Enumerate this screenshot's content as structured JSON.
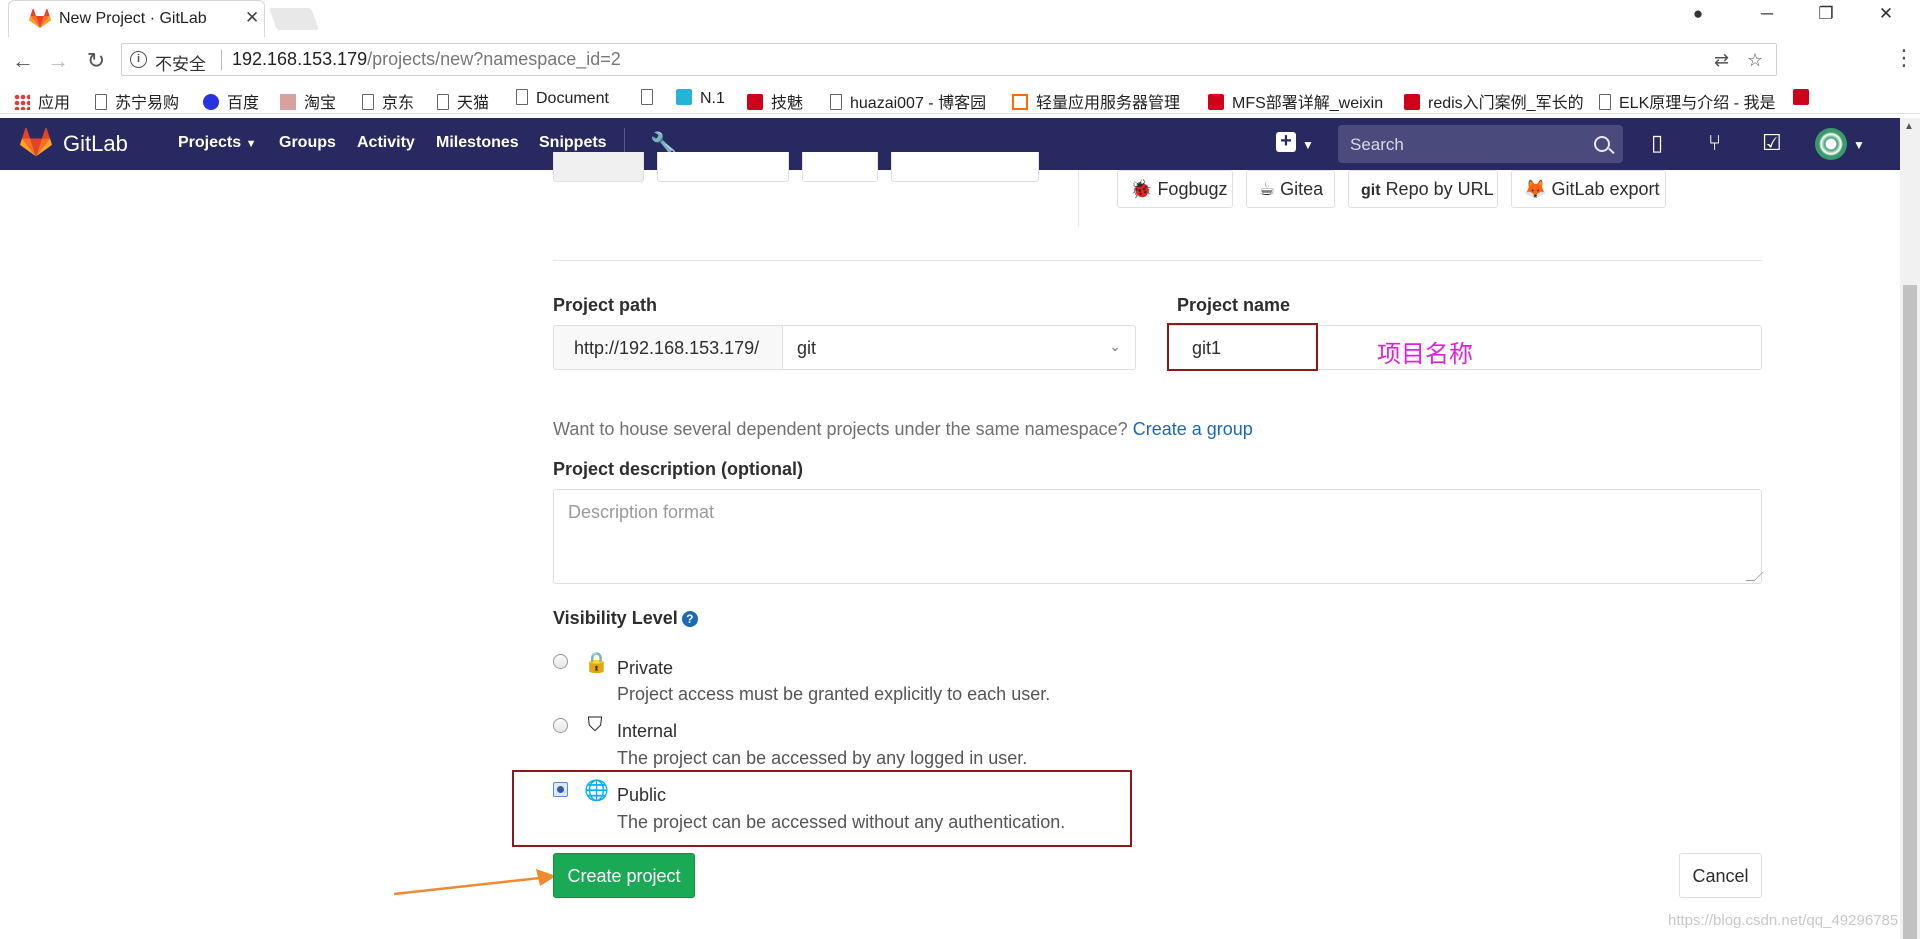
{
  "browser": {
    "tab_title": "New Project · GitLab",
    "insecure_label": "不安全",
    "url_host": "192.168.153.179",
    "url_path": "/projects/new?namespace_id=2",
    "bookmarks": [
      {
        "label": "应用",
        "icon": "apps-icon"
      },
      {
        "label": "苏宁易购",
        "icon": "page-icon"
      },
      {
        "label": "百度",
        "icon": "baidu-icon"
      },
      {
        "label": "淘宝",
        "icon": "taobao-icon"
      },
      {
        "label": "京东",
        "icon": "page-icon"
      },
      {
        "label": "天猫",
        "icon": "page-icon"
      },
      {
        "label": "Document",
        "icon": "page-icon"
      },
      {
        "label": "",
        "icon": "page-icon"
      },
      {
        "label": "N.1",
        "icon": "b-icon"
      },
      {
        "label": "技魅",
        "icon": "csdn-icon"
      },
      {
        "label": "huazai007 - 博客园",
        "icon": "page-icon"
      },
      {
        "label": "轻量应用服务器管理",
        "icon": "aliyun-icon"
      },
      {
        "label": "MFS部署详解_weixin",
        "icon": "csdn-icon"
      },
      {
        "label": "redis入门案例_军长的",
        "icon": "csdn-icon"
      },
      {
        "label": "ELK原理与介绍 - 我是",
        "icon": "page-icon"
      },
      {
        "label": "",
        "icon": "csdn-icon"
      }
    ]
  },
  "gitlab": {
    "brand": "GitLab",
    "nav": {
      "projects": "Projects",
      "groups": "Groups",
      "activity": "Activity",
      "milestones": "Milestones",
      "snippets": "Snippets"
    },
    "search_placeholder": "Search"
  },
  "import_sources": [
    "Fogbugz",
    "Gitea",
    "Repo by URL",
    "GitLab export"
  ],
  "form": {
    "project_path_label": "Project path",
    "path_prefix": "http://192.168.153.179/",
    "namespace": "git",
    "project_name_label": "Project name",
    "project_name_value": "git1",
    "annotation": "项目名称",
    "group_help_text": "Want to house several dependent projects under the same namespace?",
    "group_help_link": "Create a group",
    "description_label": "Project description (optional)",
    "description_placeholder": "Description format",
    "visibility_label": "Visibility Level",
    "visibility": [
      {
        "title": "Private",
        "desc": "Project access must be granted explicitly to each user.",
        "checked": false
      },
      {
        "title": "Internal",
        "desc": "The project can be accessed by any logged in user.",
        "checked": false
      },
      {
        "title": "Public",
        "desc": "The project can be accessed without any authentication.",
        "checked": true
      }
    ],
    "create_button": "Create project",
    "cancel_button": "Cancel"
  },
  "watermark": "https://blog.csdn.net/qq_49296785",
  "colors": {
    "header": "#292961",
    "create": "#1aaa55",
    "link": "#1b69b6",
    "annotation": "#e020e0",
    "annotation_box": "#8b1a1a"
  }
}
